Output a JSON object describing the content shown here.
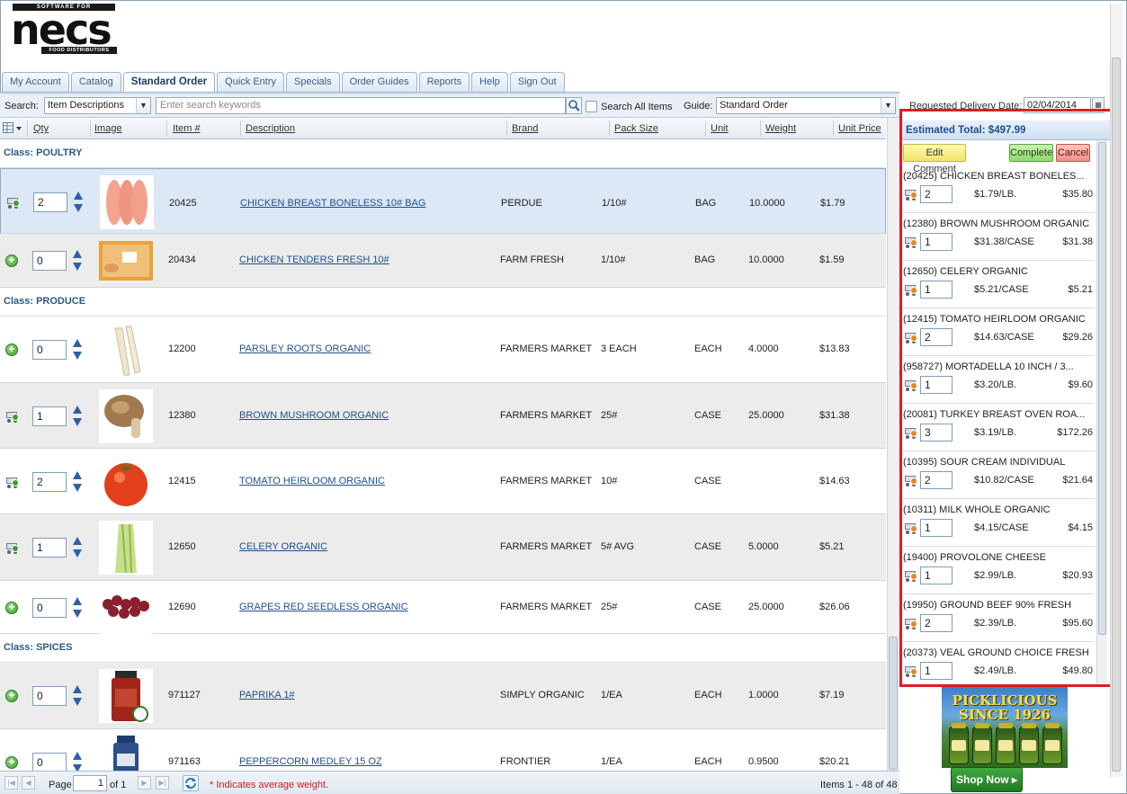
{
  "logo": {
    "top_text": "SOFTWARE FOR",
    "main_text": "necs",
    "bottom_text": "FOOD DISTRIBUTORS"
  },
  "tabs": [
    "My Account",
    "Catalog",
    "Standard Order",
    "Quick Entry",
    "Specials",
    "Order Guides",
    "Reports",
    "Help",
    "Sign Out"
  ],
  "active_tab": "Standard Order",
  "search": {
    "label": "Search:",
    "field_value": "Item Descriptions",
    "placeholder": "Enter search keywords",
    "search_all_label": "Search All Items",
    "guide_label": "Guide:",
    "guide_value": "Standard Order"
  },
  "delivery": {
    "label": "Requested Delivery Date:",
    "value": "02/04/2014"
  },
  "columns": [
    "Qty",
    "Image",
    "Item #",
    "Description",
    "Brand",
    "Pack Size",
    "Unit",
    "Weight",
    "Unit Price"
  ],
  "classes": [
    {
      "name": "Class: POULTRY",
      "items": [
        {
          "qty": "2",
          "in_cart": true,
          "item": "20425",
          "desc": "CHICKEN BREAST BONELESS 10# BAG",
          "brand": "PERDUE",
          "pack": "1/10#",
          "unit": "BAG",
          "weight": "10.0000",
          "price": "$1.79",
          "img": "chicken-breast"
        },
        {
          "qty": "0",
          "in_cart": false,
          "item": "20434",
          "desc": "CHICKEN TENDERS FRESH 10#",
          "brand": "FARM FRESH",
          "pack": "1/10#",
          "unit": "BAG",
          "weight": "10.0000",
          "price": "$1.59",
          "img": "chicken-tenders"
        }
      ]
    },
    {
      "name": "Class: PRODUCE",
      "items": [
        {
          "qty": "0",
          "in_cart": false,
          "item": "12200",
          "desc": "PARSLEY ROOTS ORGANIC",
          "brand": "FARMERS MARKET",
          "pack": "3 EACH",
          "unit": "EACH",
          "weight": "4.0000",
          "price": "$13.83",
          "img": "parsley-root"
        },
        {
          "qty": "1",
          "in_cart": true,
          "item": "12380",
          "desc": "BROWN MUSHROOM ORGANIC",
          "brand": "FARMERS MARKET",
          "pack": "25#",
          "unit": "CASE",
          "weight": "25.0000",
          "price": "$31.38",
          "img": "mushroom"
        },
        {
          "qty": "2",
          "in_cart": true,
          "item": "12415",
          "desc": "TOMATO HEIRLOOM ORGANIC",
          "brand": "FARMERS MARKET",
          "pack": "10#",
          "unit": "CASE",
          "weight": "",
          "price": "$14.63",
          "img": "tomato"
        },
        {
          "qty": "1",
          "in_cart": true,
          "item": "12650",
          "desc": "CELERY ORGANIC",
          "brand": "FARMERS MARKET",
          "pack": "5# AVG",
          "unit": "CASE",
          "weight": "5.0000",
          "price": "$5.21",
          "img": "celery"
        },
        {
          "qty": "0",
          "in_cart": false,
          "item": "12690",
          "desc": "GRAPES RED SEEDLESS ORGANIC",
          "brand": "FARMERS MARKET",
          "pack": "25#",
          "unit": "CASE",
          "weight": "25.0000",
          "price": "$26.06",
          "img": "grapes"
        }
      ]
    },
    {
      "name": "Class: SPICES",
      "items": [
        {
          "qty": "0",
          "in_cart": false,
          "item": "971127",
          "desc": "PAPRIKA 1#",
          "brand": "SIMPLY ORGANIC",
          "pack": "1/EA",
          "unit": "EACH",
          "weight": "1.0000",
          "price": "$7.19",
          "img": "paprika-jar"
        },
        {
          "qty": "0",
          "in_cart": false,
          "item": "971163",
          "desc": "PEPPERCORN MEDLEY 15 OZ",
          "brand": "FRONTIER",
          "pack": "1/EA",
          "unit": "EACH",
          "weight": "0.9500",
          "price": "$20.21",
          "img": "peppercorn-jar"
        }
      ]
    }
  ],
  "pager": {
    "page_label": "Page",
    "page_value": "1",
    "of_label": "of 1",
    "note": "* Indicates average weight.",
    "items_label": "Items 1 - 48 of 48"
  },
  "cart": {
    "estimated_total": "Estimated Total: $497.99",
    "edit_comment": "Edit Comment",
    "complete": "Complete",
    "cancel": "Cancel",
    "items": [
      {
        "name": "(20425) CHICKEN BREAST BONELES...",
        "qty": "2",
        "price": "$1.79/LB.",
        "total": "$35.80"
      },
      {
        "name": "(12380) BROWN MUSHROOM ORGANIC",
        "qty": "1",
        "price": "$31.38/CASE",
        "total": "$31.38"
      },
      {
        "name": "(12650) CELERY ORGANIC",
        "qty": "1",
        "price": "$5.21/CASE",
        "total": "$5.21"
      },
      {
        "name": "(12415) TOMATO HEIRLOOM ORGANIC",
        "qty": "2",
        "price": "$14.63/CASE",
        "total": "$29.26"
      },
      {
        "name": "(958727) MORTADELLA 10 INCH / 3...",
        "qty": "1",
        "price": "$3.20/LB.",
        "total": "$9.60"
      },
      {
        "name": "(20081) TURKEY BREAST OVEN ROA...",
        "qty": "3",
        "price": "$3.19/LB.",
        "total": "$172.26"
      },
      {
        "name": "(10395) SOUR CREAM INDIVIDUAL",
        "qty": "2",
        "price": "$10.82/CASE",
        "total": "$21.64"
      },
      {
        "name": "(10311) MILK WHOLE ORGANIC",
        "qty": "1",
        "price": "$4.15/CASE",
        "total": "$4.15"
      },
      {
        "name": "(19400) PROVOLONE CHEESE",
        "qty": "1",
        "price": "$2.99/LB.",
        "total": "$20.93"
      },
      {
        "name": "(19950) GROUND BEEF 90% FRESH",
        "qty": "2",
        "price": "$2.39/LB.",
        "total": "$95.60"
      },
      {
        "name": "(20373) VEAL GROUND CHOICE FRESH",
        "qty": "1",
        "price": "$2.49/LB.",
        "total": "$49.80"
      }
    ]
  },
  "ad": {
    "line1": "PICKLICIOUS",
    "line2": "SINCE 1926",
    "button": "Shop Now ▸"
  },
  "colors": {
    "accent": "#2d5a88",
    "highlight_border": "#e11b22",
    "link": "#1f4f8a"
  }
}
